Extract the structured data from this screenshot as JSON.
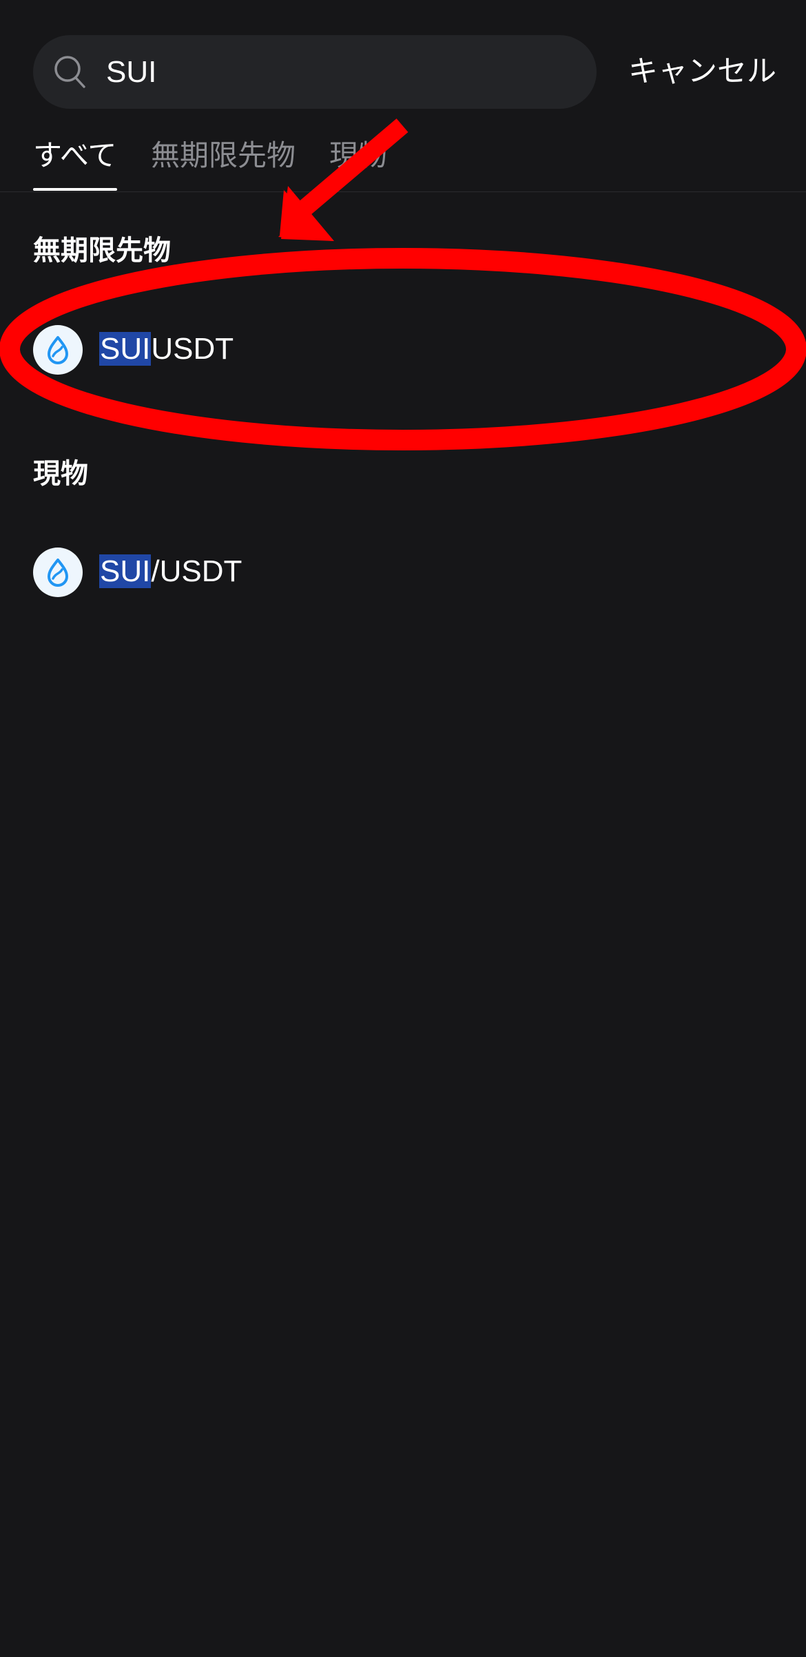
{
  "search": {
    "value": "SUI",
    "icon": "search-icon"
  },
  "header": {
    "cancel_label": "キャンセル"
  },
  "tabs": [
    {
      "label": "すべて",
      "active": true
    },
    {
      "label": "無期限先物",
      "active": false
    },
    {
      "label": "現物",
      "active": false
    }
  ],
  "sections": {
    "perpetual": {
      "title": "無期限先物",
      "items": [
        {
          "highlight": "SUI",
          "rest": "USDT",
          "icon": "sui-icon"
        }
      ]
    },
    "spot": {
      "title": "現物",
      "items": [
        {
          "highlight": "SUI",
          "rest": "/USDT",
          "icon": "sui-icon"
        }
      ]
    }
  },
  "colors": {
    "background": "#161618",
    "search_bg": "#232427",
    "highlight": "#2047a6",
    "annotation": "#ff0000",
    "sui_blue": "#2196f3"
  }
}
